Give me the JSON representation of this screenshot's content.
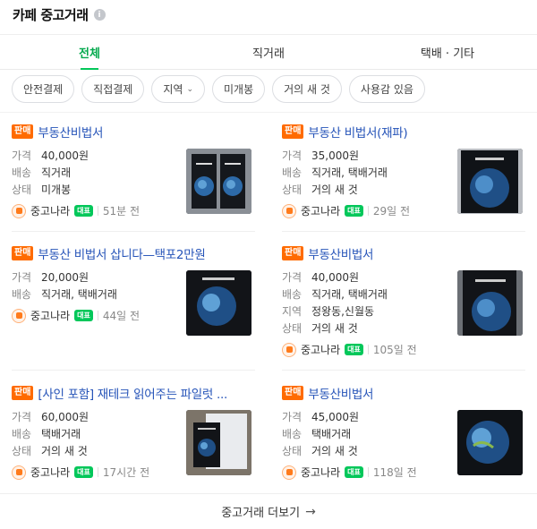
{
  "header": {
    "title": "카페 중고거래",
    "info_icon": "info-icon"
  },
  "tabs": [
    {
      "label": "전체"
    },
    {
      "label": "직거래"
    },
    {
      "label": "택배 · 기타"
    }
  ],
  "filters": [
    {
      "label": "안전결제"
    },
    {
      "label": "직접결제"
    },
    {
      "label": "지역",
      "icon": "chevron-down-icon"
    },
    {
      "label": "미개봉"
    },
    {
      "label": "거의 새 것"
    },
    {
      "label": "사용감 있음"
    }
  ],
  "listings": [
    {
      "badge": "판매",
      "title": "부동산비법서",
      "rows": [
        {
          "k": "가격",
          "v": "40,000원"
        },
        {
          "k": "배송",
          "v": "직거래"
        },
        {
          "k": "상태",
          "v": "미개봉"
        }
      ],
      "source": "중고나라",
      "rep_badge": "대표",
      "time": "51분 전"
    },
    {
      "badge": "판매",
      "title": "부동산 비법서(재파)",
      "rows": [
        {
          "k": "가격",
          "v": "35,000원"
        },
        {
          "k": "배송",
          "v": "직거래, 택배거래"
        },
        {
          "k": "상태",
          "v": "거의 새 것"
        }
      ],
      "source": "중고나라",
      "rep_badge": "대표",
      "time": "29일 전"
    },
    {
      "badge": "판매",
      "title": "부동산 비법서 삽니다—택포2만원",
      "rows": [
        {
          "k": "가격",
          "v": "20,000원"
        },
        {
          "k": "배송",
          "v": "직거래, 택배거래"
        }
      ],
      "source": "중고나라",
      "rep_badge": "대표",
      "time": "44일 전"
    },
    {
      "badge": "판매",
      "title": "부동산비법서",
      "rows": [
        {
          "k": "가격",
          "v": "40,000원"
        },
        {
          "k": "배송",
          "v": "직거래, 택배거래"
        },
        {
          "k": "지역",
          "v": "정왕동,신월동"
        },
        {
          "k": "상태",
          "v": "거의 새 것"
        }
      ],
      "source": "중고나라",
      "rep_badge": "대표",
      "time": "105일 전"
    },
    {
      "badge": "판매",
      "title": "[사인 포함] 재테크 읽어주는 파일럿 ...",
      "rows": [
        {
          "k": "가격",
          "v": "60,000원"
        },
        {
          "k": "배송",
          "v": "택배거래"
        },
        {
          "k": "상태",
          "v": "거의 새 것"
        }
      ],
      "source": "중고나라",
      "rep_badge": "대표",
      "time": "17시간 전"
    },
    {
      "badge": "판매",
      "title": "부동산비법서",
      "rows": [
        {
          "k": "가격",
          "v": "45,000원"
        },
        {
          "k": "배송",
          "v": "택배거래"
        },
        {
          "k": "상태",
          "v": "거의 새 것"
        }
      ],
      "source": "중고나라",
      "rep_badge": "대표",
      "time": "118일 전"
    }
  ],
  "footer": {
    "label": "중고거래 더보기",
    "icon": "arrow-right-icon"
  },
  "colors": {
    "accent": "#03c75a",
    "badge": "#ff6b00",
    "link": "#2553b8"
  }
}
